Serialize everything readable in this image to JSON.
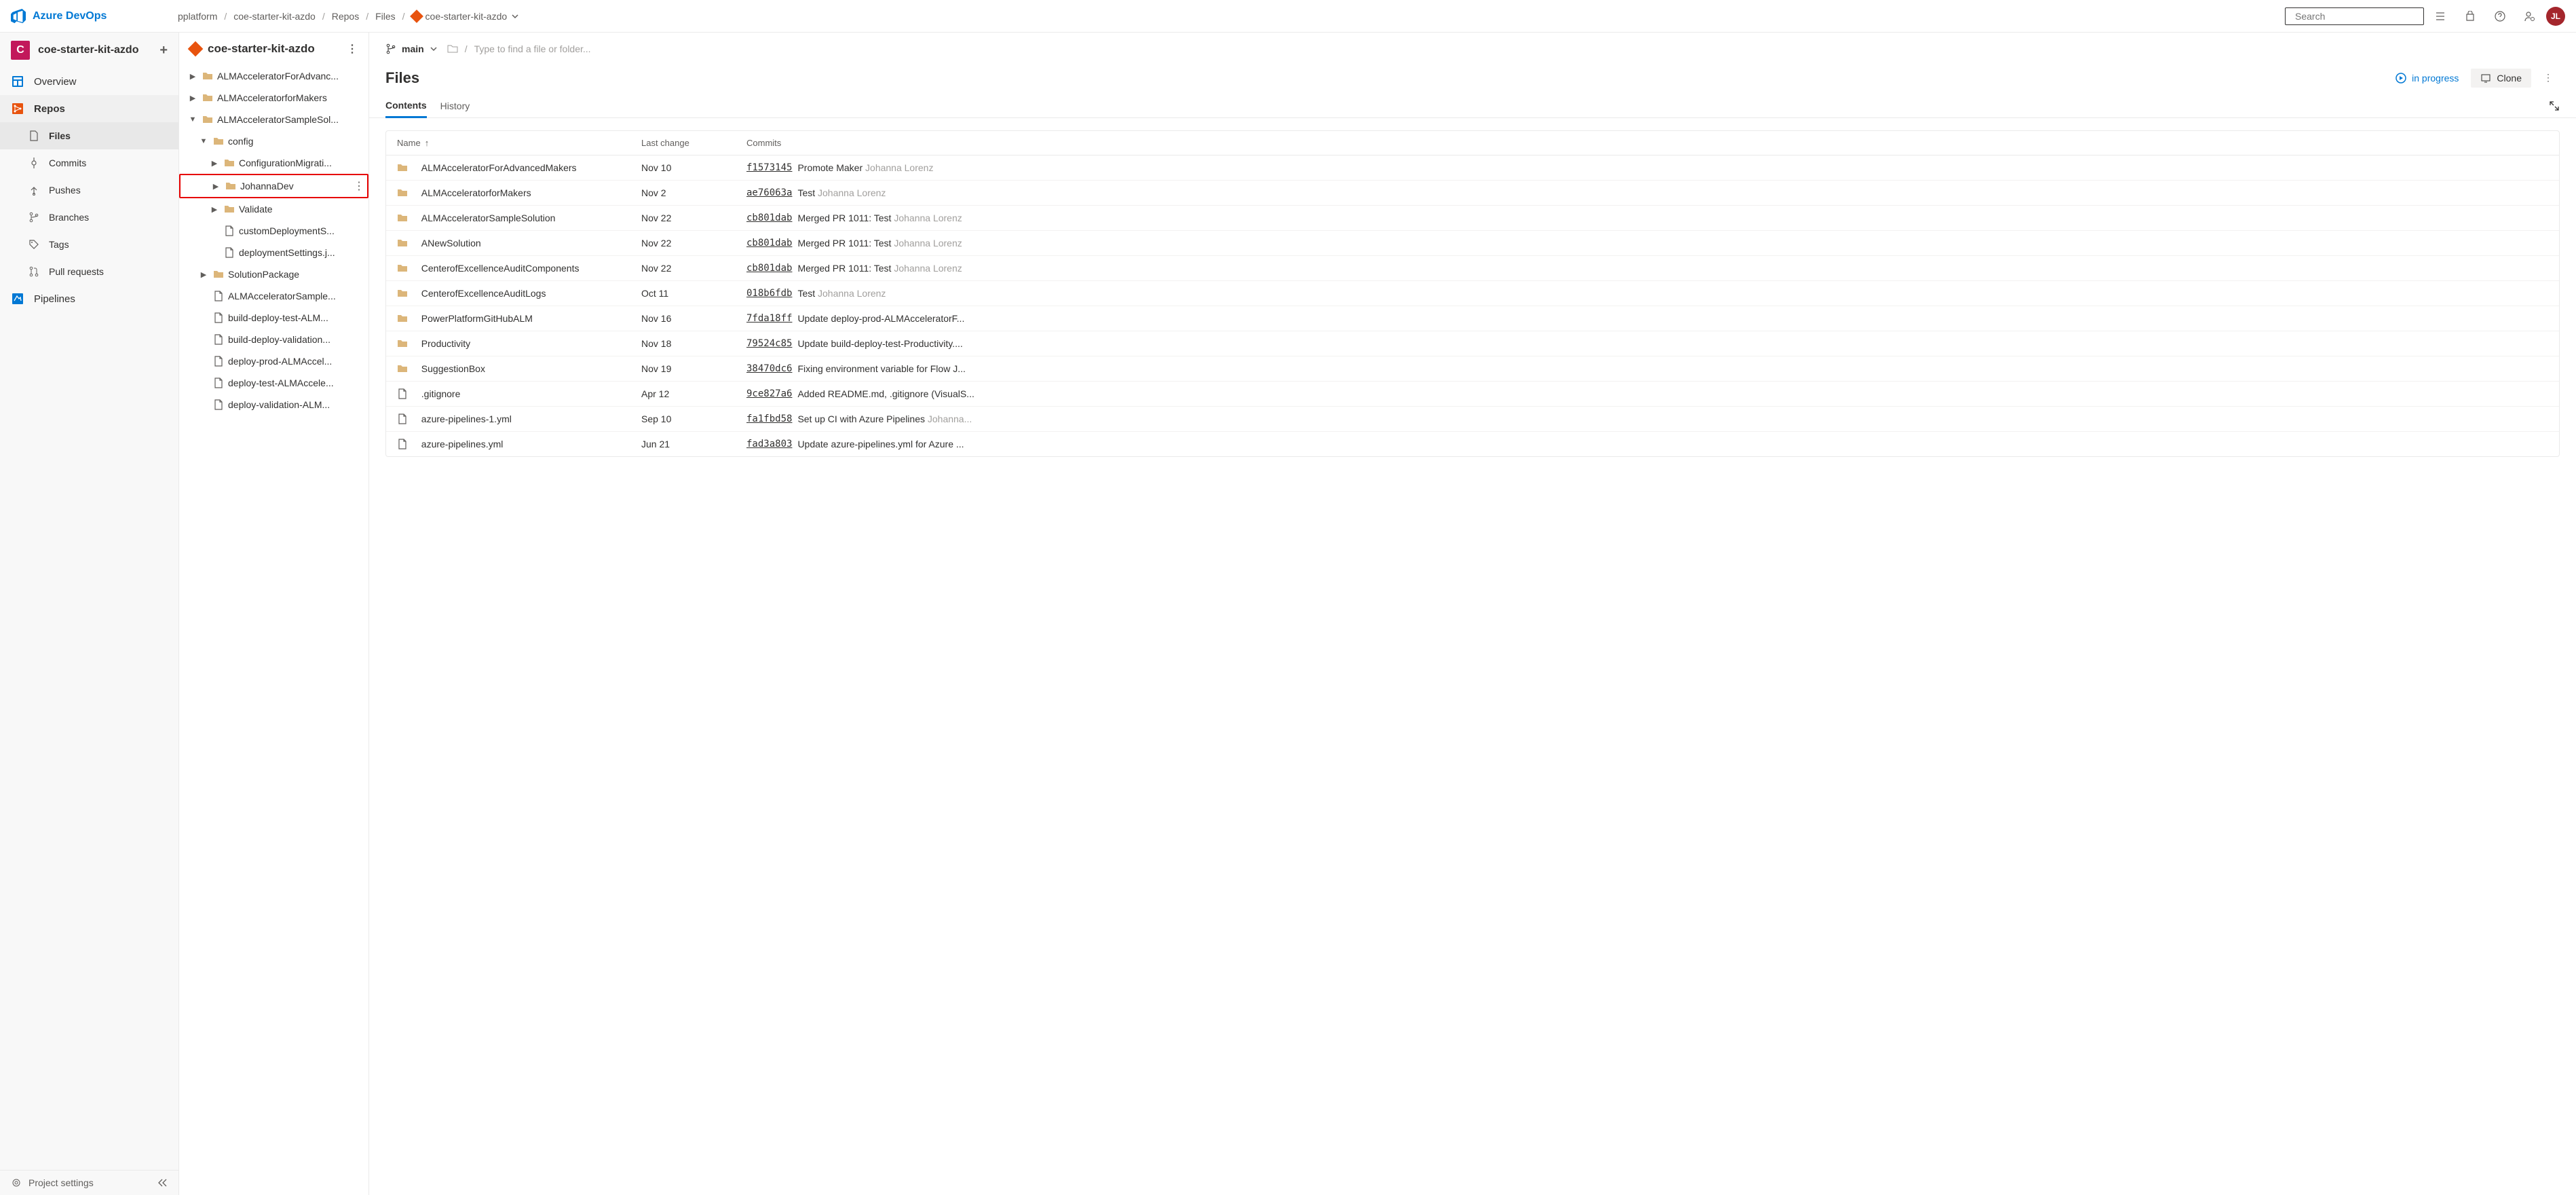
{
  "topbar": {
    "logo_text": "Azure DevOps",
    "breadcrumb": [
      "pplatform",
      "coe-starter-kit-azdo",
      "Repos",
      "Files"
    ],
    "breadcrumb_repo": "coe-starter-kit-azdo",
    "search_placeholder": "Search",
    "avatar": "JL"
  },
  "sidebar": {
    "project_icon": "C",
    "project_name": "coe-starter-kit-azdo",
    "nav": [
      {
        "label": "Overview",
        "icon": "overview"
      },
      {
        "label": "Repos",
        "icon": "repos",
        "active_parent": true
      },
      {
        "label": "Files",
        "sub": true,
        "active": true
      },
      {
        "label": "Commits",
        "sub": true
      },
      {
        "label": "Pushes",
        "sub": true
      },
      {
        "label": "Branches",
        "sub": true
      },
      {
        "label": "Tags",
        "sub": true
      },
      {
        "label": "Pull requests",
        "sub": true
      },
      {
        "label": "Pipelines",
        "icon": "pipelines"
      }
    ],
    "footer": "Project settings"
  },
  "tree": {
    "repo_name": "coe-starter-kit-azdo",
    "items": [
      {
        "type": "folder",
        "label": "ALMAcceleratorForAdvanc...",
        "level": 1,
        "chev": "right"
      },
      {
        "type": "folder",
        "label": "ALMAcceleratorforMakers",
        "level": 1,
        "chev": "right"
      },
      {
        "type": "folder",
        "label": "ALMAcceleratorSampleSol...",
        "level": 1,
        "chev": "down"
      },
      {
        "type": "folder",
        "label": "config",
        "level": 2,
        "chev": "down"
      },
      {
        "type": "folder",
        "label": "ConfigurationMigrati...",
        "level": 3,
        "chev": "right"
      },
      {
        "type": "folder",
        "label": "JohannaDev",
        "level": 3,
        "chev": "right",
        "highlight": true,
        "more": true
      },
      {
        "type": "folder",
        "label": "Validate",
        "level": 3,
        "chev": "right"
      },
      {
        "type": "file",
        "label": "customDeploymentS...",
        "level": 3
      },
      {
        "type": "file",
        "label": "deploymentSettings.j...",
        "level": 3
      },
      {
        "type": "folder",
        "label": "SolutionPackage",
        "level": 2,
        "chev": "right"
      },
      {
        "type": "file",
        "label": "ALMAcceleratorSample...",
        "level": 2
      },
      {
        "type": "file",
        "label": "build-deploy-test-ALM...",
        "level": 2
      },
      {
        "type": "file",
        "label": "build-deploy-validation...",
        "level": 2
      },
      {
        "type": "file",
        "label": "deploy-prod-ALMAccel...",
        "level": 2
      },
      {
        "type": "file",
        "label": "deploy-test-ALMAccele...",
        "level": 2
      },
      {
        "type": "file",
        "label": "deploy-validation-ALM...",
        "level": 2
      }
    ]
  },
  "content": {
    "branch": "main",
    "path_placeholder": "Type to find a file or folder...",
    "title": "Files",
    "progress_label": "in progress",
    "clone_label": "Clone",
    "tabs": [
      "Contents",
      "History"
    ],
    "table_headers": {
      "name": "Name",
      "date": "Last change",
      "commits": "Commits"
    },
    "rows": [
      {
        "icon": "folder",
        "name": "ALMAcceleratorForAdvancedMakers",
        "date": "Nov 10",
        "hash": "f1573145",
        "msg": "Promote Maker",
        "author": "Johanna Lorenz"
      },
      {
        "icon": "folder",
        "name": "ALMAcceleratorforMakers",
        "date": "Nov 2",
        "hash": "ae76063a",
        "msg": "Test",
        "author": "Johanna Lorenz"
      },
      {
        "icon": "folder",
        "name": "ALMAcceleratorSampleSolution",
        "date": "Nov 22",
        "hash": "cb801dab",
        "msg": "Merged PR 1011: Test",
        "author": "Johanna Lorenz"
      },
      {
        "icon": "folder",
        "name": "ANewSolution",
        "date": "Nov 22",
        "hash": "cb801dab",
        "msg": "Merged PR 1011: Test",
        "author": "Johanna Lorenz"
      },
      {
        "icon": "folder",
        "name": "CenterofExcellenceAuditComponents",
        "date": "Nov 22",
        "hash": "cb801dab",
        "msg": "Merged PR 1011: Test",
        "author": "Johanna Lorenz"
      },
      {
        "icon": "folder",
        "name": "CenterofExcellenceAuditLogs",
        "date": "Oct 11",
        "hash": "018b6fdb",
        "msg": "Test",
        "author": "Johanna Lorenz"
      },
      {
        "icon": "folder",
        "name": "PowerPlatformGitHubALM",
        "date": "Nov 16",
        "hash": "7fda18ff",
        "msg": "Update deploy-prod-ALMAcceleratorF...",
        "author": ""
      },
      {
        "icon": "folder",
        "name": "Productivity",
        "date": "Nov 18",
        "hash": "79524c85",
        "msg": "Update build-deploy-test-Productivity....",
        "author": ""
      },
      {
        "icon": "folder",
        "name": "SuggestionBox",
        "date": "Nov 19",
        "hash": "38470dc6",
        "msg": "Fixing environment variable for Flow J...",
        "author": ""
      },
      {
        "icon": "file",
        "name": ".gitignore",
        "date": "Apr 12",
        "hash": "9ce827a6",
        "msg": "Added README.md, .gitignore (VisualS...",
        "author": ""
      },
      {
        "icon": "file",
        "name": "azure-pipelines-1.yml",
        "date": "Sep 10",
        "hash": "fa1fbd58",
        "msg": "Set up CI with Azure Pipelines",
        "author": "Johanna..."
      },
      {
        "icon": "file",
        "name": "azure-pipelines.yml",
        "date": "Jun 21",
        "hash": "fad3a803",
        "msg": "Update azure-pipelines.yml for Azure ...",
        "author": ""
      }
    ]
  }
}
